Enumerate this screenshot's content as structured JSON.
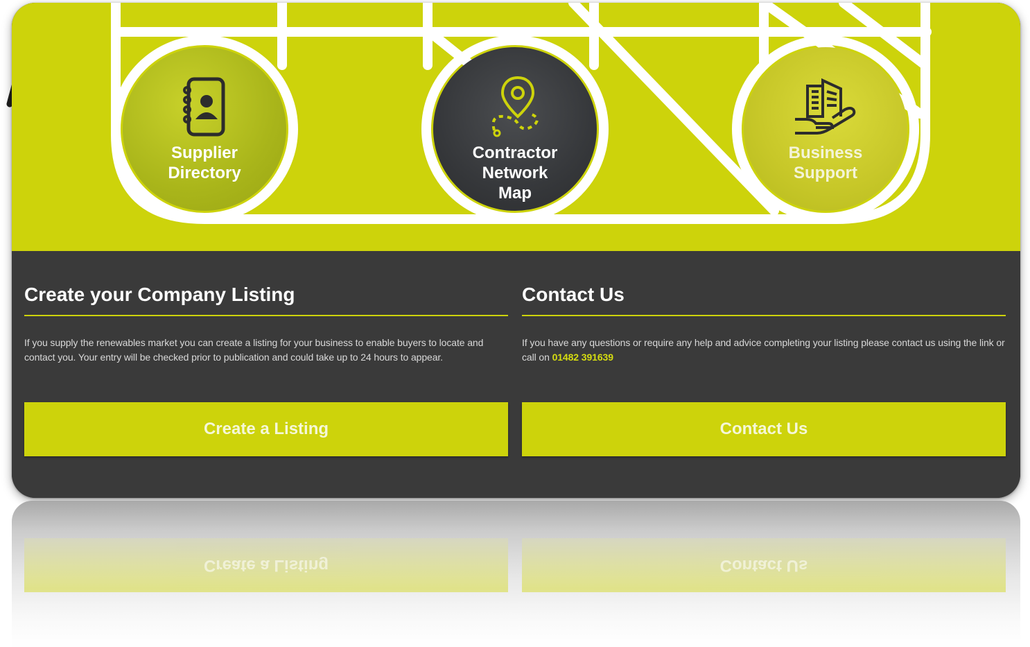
{
  "hero": {
    "background_color": "#cdd30b",
    "tiles": [
      {
        "label": "Supplier\nDirectory",
        "icon": "address-book-icon"
      },
      {
        "label": "Contractor\nNetwork\nMap",
        "icon": "location-pin-route-icon"
      },
      {
        "label": "Business\nSupport",
        "icon": "building-in-hand-icon"
      }
    ]
  },
  "listing": {
    "title": "Create your Company Listing",
    "body": "If you supply the renewables market you can create a listing for your business to enable buyers to locate and contact you. Your entry will be checked prior to publication and could take up to 24 hours to appear.",
    "button_label": "Create a Listing"
  },
  "contact": {
    "title": "Contact Us",
    "body_prefix": "If you have any questions or require any help and advice completing your listing please contact us using the link or call on ",
    "phone": "01482 391639",
    "button_label": "Contact Us"
  },
  "colors": {
    "accent": "#cdd30b",
    "dark_panel": "#3a3a3a",
    "text_light": "#ffffff"
  }
}
